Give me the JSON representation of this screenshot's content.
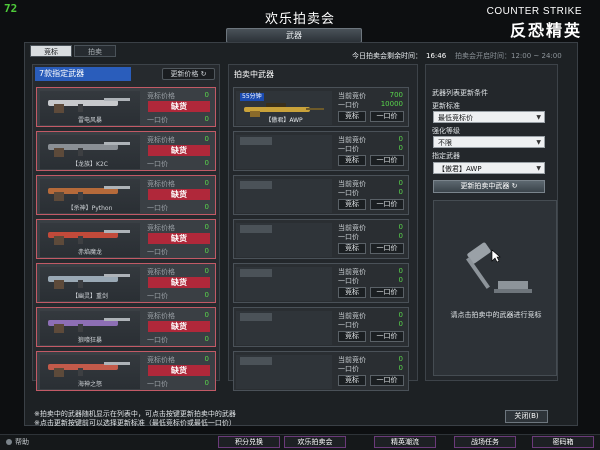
{
  "fps": "72",
  "header": {
    "title": "欢乐拍卖会",
    "category_tab": "武器",
    "logo_en": "COUNTER STRIKE",
    "logo_cn": "反恐精英"
  },
  "tabs": [
    {
      "label": "竞标",
      "active": true
    },
    {
      "label": "拍卖",
      "active": false
    }
  ],
  "countdown": {
    "label": "今日拍卖会剩余时间：",
    "value": "16:46"
  },
  "auction_time": {
    "label": "拍卖会开启时间：",
    "value": "12:00 ~ 24:00"
  },
  "left": {
    "title": "7款指定武器",
    "refresh_label": "更新价格",
    "price_label": "竞标价格",
    "buy_label": "一口价",
    "sold_label": "缺货",
    "items": [
      {
        "name": "雷电风暴",
        "bid": "0",
        "buy": "0"
      },
      {
        "name": "【龙族】K2C",
        "bid": "0",
        "buy": "0"
      },
      {
        "name": "【杀神】Python",
        "bid": "0",
        "buy": "0"
      },
      {
        "name": "赤焰魔龙",
        "bid": "0",
        "buy": "0"
      },
      {
        "name": "【幽灵】重剑",
        "bid": "0",
        "buy": "0"
      },
      {
        "name": "狼嚎狂暴",
        "bid": "0",
        "buy": "0"
      },
      {
        "name": "海神之怒",
        "bid": "0",
        "buy": "0"
      }
    ]
  },
  "middle": {
    "title": "拍卖中武器",
    "price_label": "当前竞价",
    "buy_label": "一口价",
    "bid_btn": "竞标",
    "buy_btn": "一口价",
    "items": [
      {
        "tag": "55分钟",
        "name": "【傲君】AWP",
        "price": "700",
        "buy": "10000"
      },
      {
        "tag": "",
        "name": "",
        "price": "0",
        "buy": "0"
      },
      {
        "tag": "",
        "name": "",
        "price": "0",
        "buy": "0"
      },
      {
        "tag": "",
        "name": "",
        "price": "0",
        "buy": "0"
      },
      {
        "tag": "",
        "name": "",
        "price": "0",
        "buy": "0"
      },
      {
        "tag": "",
        "name": "",
        "price": "0",
        "buy": "0"
      },
      {
        "tag": "",
        "name": "",
        "price": "0",
        "buy": "0"
      }
    ]
  },
  "right": {
    "section_title": "武器列表更新条件",
    "criteria_label": "更新标准",
    "criteria_value": "最低竞标价",
    "level_label": "强化等级",
    "level_value": "不限",
    "weapon_label": "指定武器",
    "weapon_value": "【傲君】AWP",
    "update_btn": "更新拍卖中武器",
    "preview_message": "请点击拍卖中的武器进行竞标"
  },
  "notes": [
    "※拍卖中的武器随机显示在列表中，可点击按键更新拍卖中的武器",
    "※点击更新按键前可以选择更新标准（最低竞标价或最低一口价）"
  ],
  "close_btn": "关闭(B)",
  "bottom": {
    "friends": "帮助",
    "buttons": [
      "积分兑换",
      "欢乐拍卖会",
      "精英潮流",
      "战场任务",
      "密码箱"
    ]
  },
  "colors": {
    "sold_red": "#b0283a",
    "value_green": "#59d64c",
    "title_blue": "#2a5dbb"
  }
}
